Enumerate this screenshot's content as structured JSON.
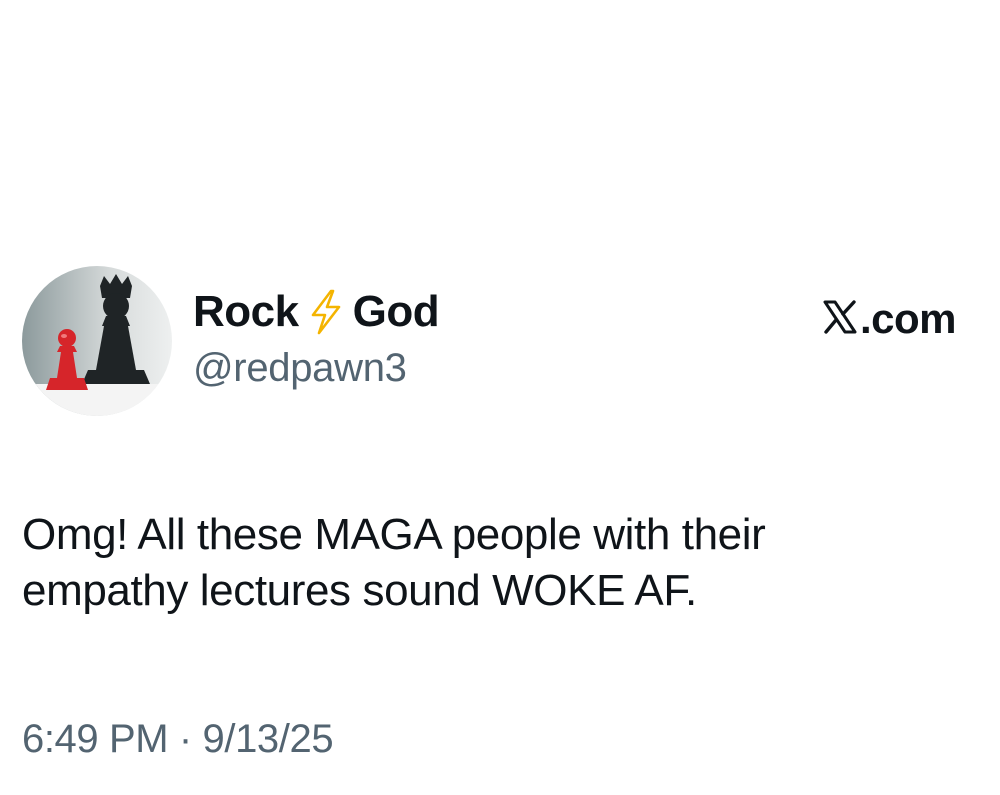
{
  "author": {
    "name_first": "Rock",
    "name_emoji": "lightning-bolt-icon",
    "name_last": "God",
    "handle": "@redpawn3",
    "avatar": "red-pawn-with-king-shadow"
  },
  "brand": {
    "logo": "x-logo-icon",
    "text": ".com"
  },
  "tweet": {
    "lines": [
      "Omg! All these MAGA people with their",
      "empathy lectures sound WOKE AF."
    ],
    "timestamp": "6:49 PM · 9/13/25"
  },
  "colors": {
    "text_primary": "#0f1419",
    "text_secondary": "#536471",
    "bolt": "#f4b400",
    "pawn": "#d6252a"
  }
}
